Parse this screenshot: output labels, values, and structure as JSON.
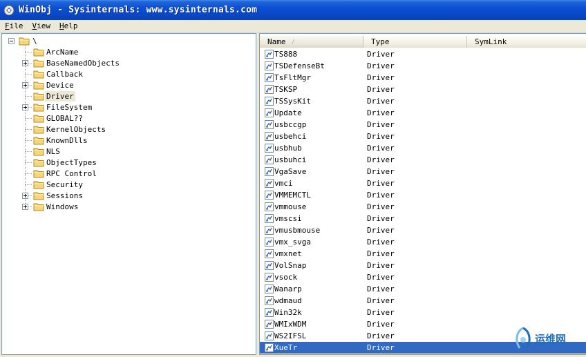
{
  "window": {
    "title": "WinObj - Sysinternals: www.sysinternals.com"
  },
  "menu": [
    {
      "key": "F",
      "rest": "ile"
    },
    {
      "key": "V",
      "rest": "iew"
    },
    {
      "key": "H",
      "rest": "elp"
    }
  ],
  "tree": {
    "root": "\\",
    "items": [
      {
        "label": "ArcName",
        "expandable": false,
        "selected": false
      },
      {
        "label": "BaseNamedObjects",
        "expandable": true,
        "selected": false
      },
      {
        "label": "Callback",
        "expandable": false,
        "selected": false
      },
      {
        "label": "Device",
        "expandable": true,
        "selected": false
      },
      {
        "label": "Driver",
        "expandable": false,
        "selected": true
      },
      {
        "label": "FileSystem",
        "expandable": true,
        "selected": false
      },
      {
        "label": "GLOBAL??",
        "expandable": false,
        "selected": false
      },
      {
        "label": "KernelObjects",
        "expandable": false,
        "selected": false
      },
      {
        "label": "KnownDlls",
        "expandable": false,
        "selected": false
      },
      {
        "label": "NLS",
        "expandable": false,
        "selected": false
      },
      {
        "label": "ObjectTypes",
        "expandable": false,
        "selected": false
      },
      {
        "label": "RPC Control",
        "expandable": false,
        "selected": false
      },
      {
        "label": "Security",
        "expandable": false,
        "selected": false
      },
      {
        "label": "Sessions",
        "expandable": true,
        "selected": false
      },
      {
        "label": "Windows",
        "expandable": true,
        "selected": false
      }
    ]
  },
  "list": {
    "columns": [
      "Name",
      "Type",
      "SymLink"
    ],
    "sort_indicator": "/",
    "rows": [
      {
        "name": "TS888",
        "type": "Driver",
        "symlink": ""
      },
      {
        "name": "TSDefenseBt",
        "type": "Driver",
        "symlink": ""
      },
      {
        "name": "TsFltMgr",
        "type": "Driver",
        "symlink": ""
      },
      {
        "name": "TSKSP",
        "type": "Driver",
        "symlink": ""
      },
      {
        "name": "TSSysKit",
        "type": "Driver",
        "symlink": ""
      },
      {
        "name": "Update",
        "type": "Driver",
        "symlink": ""
      },
      {
        "name": "usbccgp",
        "type": "Driver",
        "symlink": ""
      },
      {
        "name": "usbehci",
        "type": "Driver",
        "symlink": ""
      },
      {
        "name": "usbhub",
        "type": "Driver",
        "symlink": ""
      },
      {
        "name": "usbuhci",
        "type": "Driver",
        "symlink": ""
      },
      {
        "name": "VgaSave",
        "type": "Driver",
        "symlink": ""
      },
      {
        "name": "vmci",
        "type": "Driver",
        "symlink": ""
      },
      {
        "name": "VMMEMCTL",
        "type": "Driver",
        "symlink": ""
      },
      {
        "name": "vmmouse",
        "type": "Driver",
        "symlink": ""
      },
      {
        "name": "vmscsi",
        "type": "Driver",
        "symlink": ""
      },
      {
        "name": "vmusbmouse",
        "type": "Driver",
        "symlink": ""
      },
      {
        "name": "vmx_svga",
        "type": "Driver",
        "symlink": ""
      },
      {
        "name": "vmxnet",
        "type": "Driver",
        "symlink": ""
      },
      {
        "name": "VolSnap",
        "type": "Driver",
        "symlink": ""
      },
      {
        "name": "vsock",
        "type": "Driver",
        "symlink": ""
      },
      {
        "name": "Wanarp",
        "type": "Driver",
        "symlink": ""
      },
      {
        "name": "wdmaud",
        "type": "Driver",
        "symlink": ""
      },
      {
        "name": "Win32k",
        "type": "Driver",
        "symlink": ""
      },
      {
        "name": "WMIxWDM",
        "type": "Driver",
        "symlink": ""
      },
      {
        "name": "WS2IFSL",
        "type": "Driver",
        "symlink": ""
      },
      {
        "name": "XueTr",
        "type": "Driver",
        "symlink": "",
        "selected": true
      }
    ]
  },
  "watermark": {
    "text": "运维网",
    "icon": "watermark-swirl-icon"
  },
  "colors": {
    "titlebar": "#0a4fd4",
    "selection": "#316ac5",
    "folder": "#f5d67a"
  }
}
